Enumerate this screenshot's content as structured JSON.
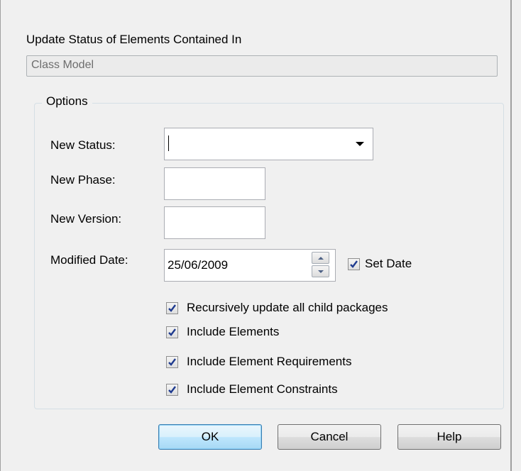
{
  "dialog": {
    "heading": "Update Status of Elements Contained In",
    "package_name": "Class Model"
  },
  "options": {
    "group_title": "Options",
    "new_status": {
      "label": "New Status:",
      "value": ""
    },
    "new_phase": {
      "label": "New Phase:",
      "value": ""
    },
    "new_version": {
      "label": "New Version:",
      "value": ""
    },
    "modified_date": {
      "label": "Modified Date:",
      "value": "25/06/2009"
    },
    "set_date": {
      "label": "Set Date",
      "checked": true
    },
    "checkboxes": [
      {
        "label": "Recursively update all child packages",
        "checked": true
      },
      {
        "label": "Include Elements",
        "checked": true
      },
      {
        "label": "Include Element Requirements",
        "checked": true
      },
      {
        "label": "Include Element Constraints",
        "checked": true
      }
    ]
  },
  "buttons": {
    "ok": "OK",
    "cancel": "Cancel",
    "help": "Help"
  },
  "icons": {
    "dropdown": "chevron-down-icon",
    "spin_up": "spin-up-icon",
    "spin_down": "spin-down-icon",
    "check": "check-icon"
  },
  "colors": {
    "check_mark": "#1f3b8f",
    "default_button_border": "#3c7fb1"
  }
}
